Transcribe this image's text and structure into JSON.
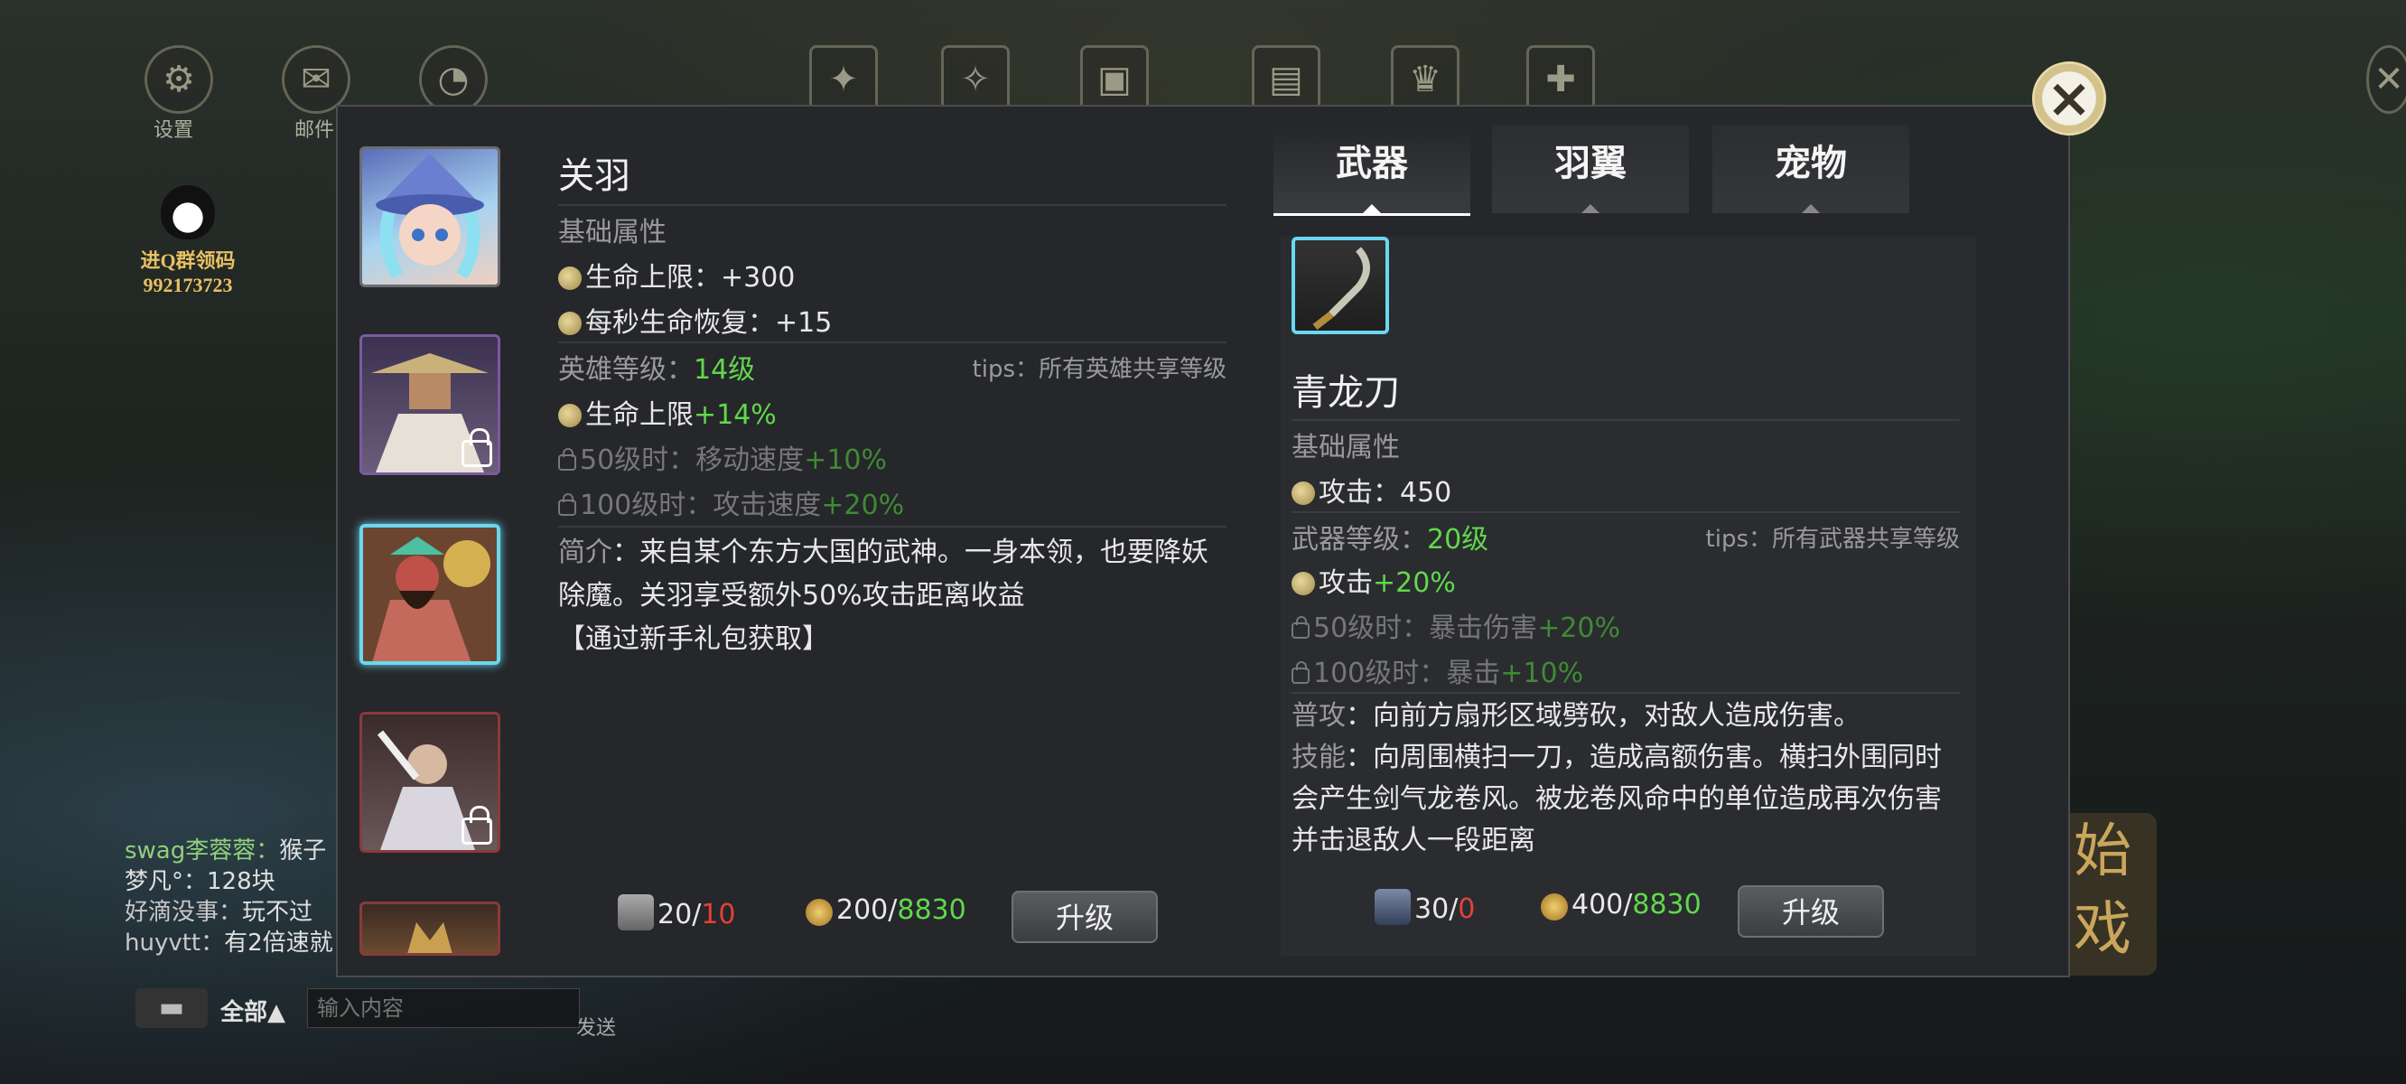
{
  "top_bar": {
    "settings_label": "设置",
    "mail_label": "邮件"
  },
  "qq_group": {
    "line1": "进Q群领码",
    "line2": "992173723"
  },
  "chat": {
    "messages": [
      {
        "name": "swag李蓉蓉：",
        "text": "猴子"
      },
      {
        "name": "梦凡°：",
        "text": "128块"
      },
      {
        "name": "好滴没事：",
        "text": "玩不过"
      },
      {
        "name": "huyvtt：",
        "text": "有2倍速就"
      }
    ],
    "channel": "全部▲",
    "input_placeholder": "输入内容",
    "send_label": "发送"
  },
  "start_button": "始戏",
  "hero_panel": {
    "name": "关羽",
    "base_attr_title": "基础属性",
    "base_attrs": [
      "生命上限：+300",
      "每秒生命恢复：+15"
    ],
    "level_label": "英雄等级：",
    "level_value": "14级",
    "level_tips": "tips：所有英雄共享等级",
    "level_bonus_label": "生命上限",
    "level_bonus_value": "+14%",
    "locked_1_label": "50级时：移动速度",
    "locked_1_value": "+10%",
    "locked_2_label": "100级时：攻击速度",
    "locked_2_value": "+20%",
    "intro_label": "简介",
    "intro_text": "：来自某个东方大国的武神。一身本领，也要降妖除魔。关羽享受额外50%攻击距离收益",
    "intro_source": "【通过新手礼包获取】",
    "cost_item_have": "20",
    "cost_item_sep": "/",
    "cost_item_need": "10",
    "cost_gold_have": "200",
    "cost_gold_sep": "/",
    "cost_gold_total": "8830",
    "upgrade_label": "升级"
  },
  "tabs": [
    {
      "label": "武器",
      "active": true
    },
    {
      "label": "羽翼",
      "active": false
    },
    {
      "label": "宠物",
      "active": false
    }
  ],
  "weapon_panel": {
    "name": "青龙刀",
    "base_attr_title": "基础属性",
    "base_attr": "攻击：450",
    "level_label": "武器等级：",
    "level_value": "20级",
    "level_tips": "tips：所有武器共享等级",
    "level_bonus_label": "攻击",
    "level_bonus_value": "+20%",
    "locked_1_label": "50级时：暴击伤害",
    "locked_1_value": "+20%",
    "locked_2_label": "100级时：暴击",
    "locked_2_value": "+10%",
    "normal_label": "普攻",
    "normal_text": "：向前方扇形区域劈砍，对敌人造成伤害。",
    "skill_label": "技能",
    "skill_text": "：向周围横扫一刀，造成高额伤害。横扫外围同时会产生剑气龙卷风。被龙卷风命中的单位造成再次伤害并击退敌人一段距离",
    "cost_item_have": "30",
    "cost_item_sep": "/",
    "cost_item_need": "0",
    "cost_gold_have": "400",
    "cost_gold_sep": "/",
    "cost_gold_total": "8830",
    "upgrade_label": "升级"
  },
  "colors": {
    "accent_cyan": "#69d8f0",
    "green_value": "#61d84c",
    "red_value": "#e2413a",
    "panel_bg": "#25272a"
  }
}
